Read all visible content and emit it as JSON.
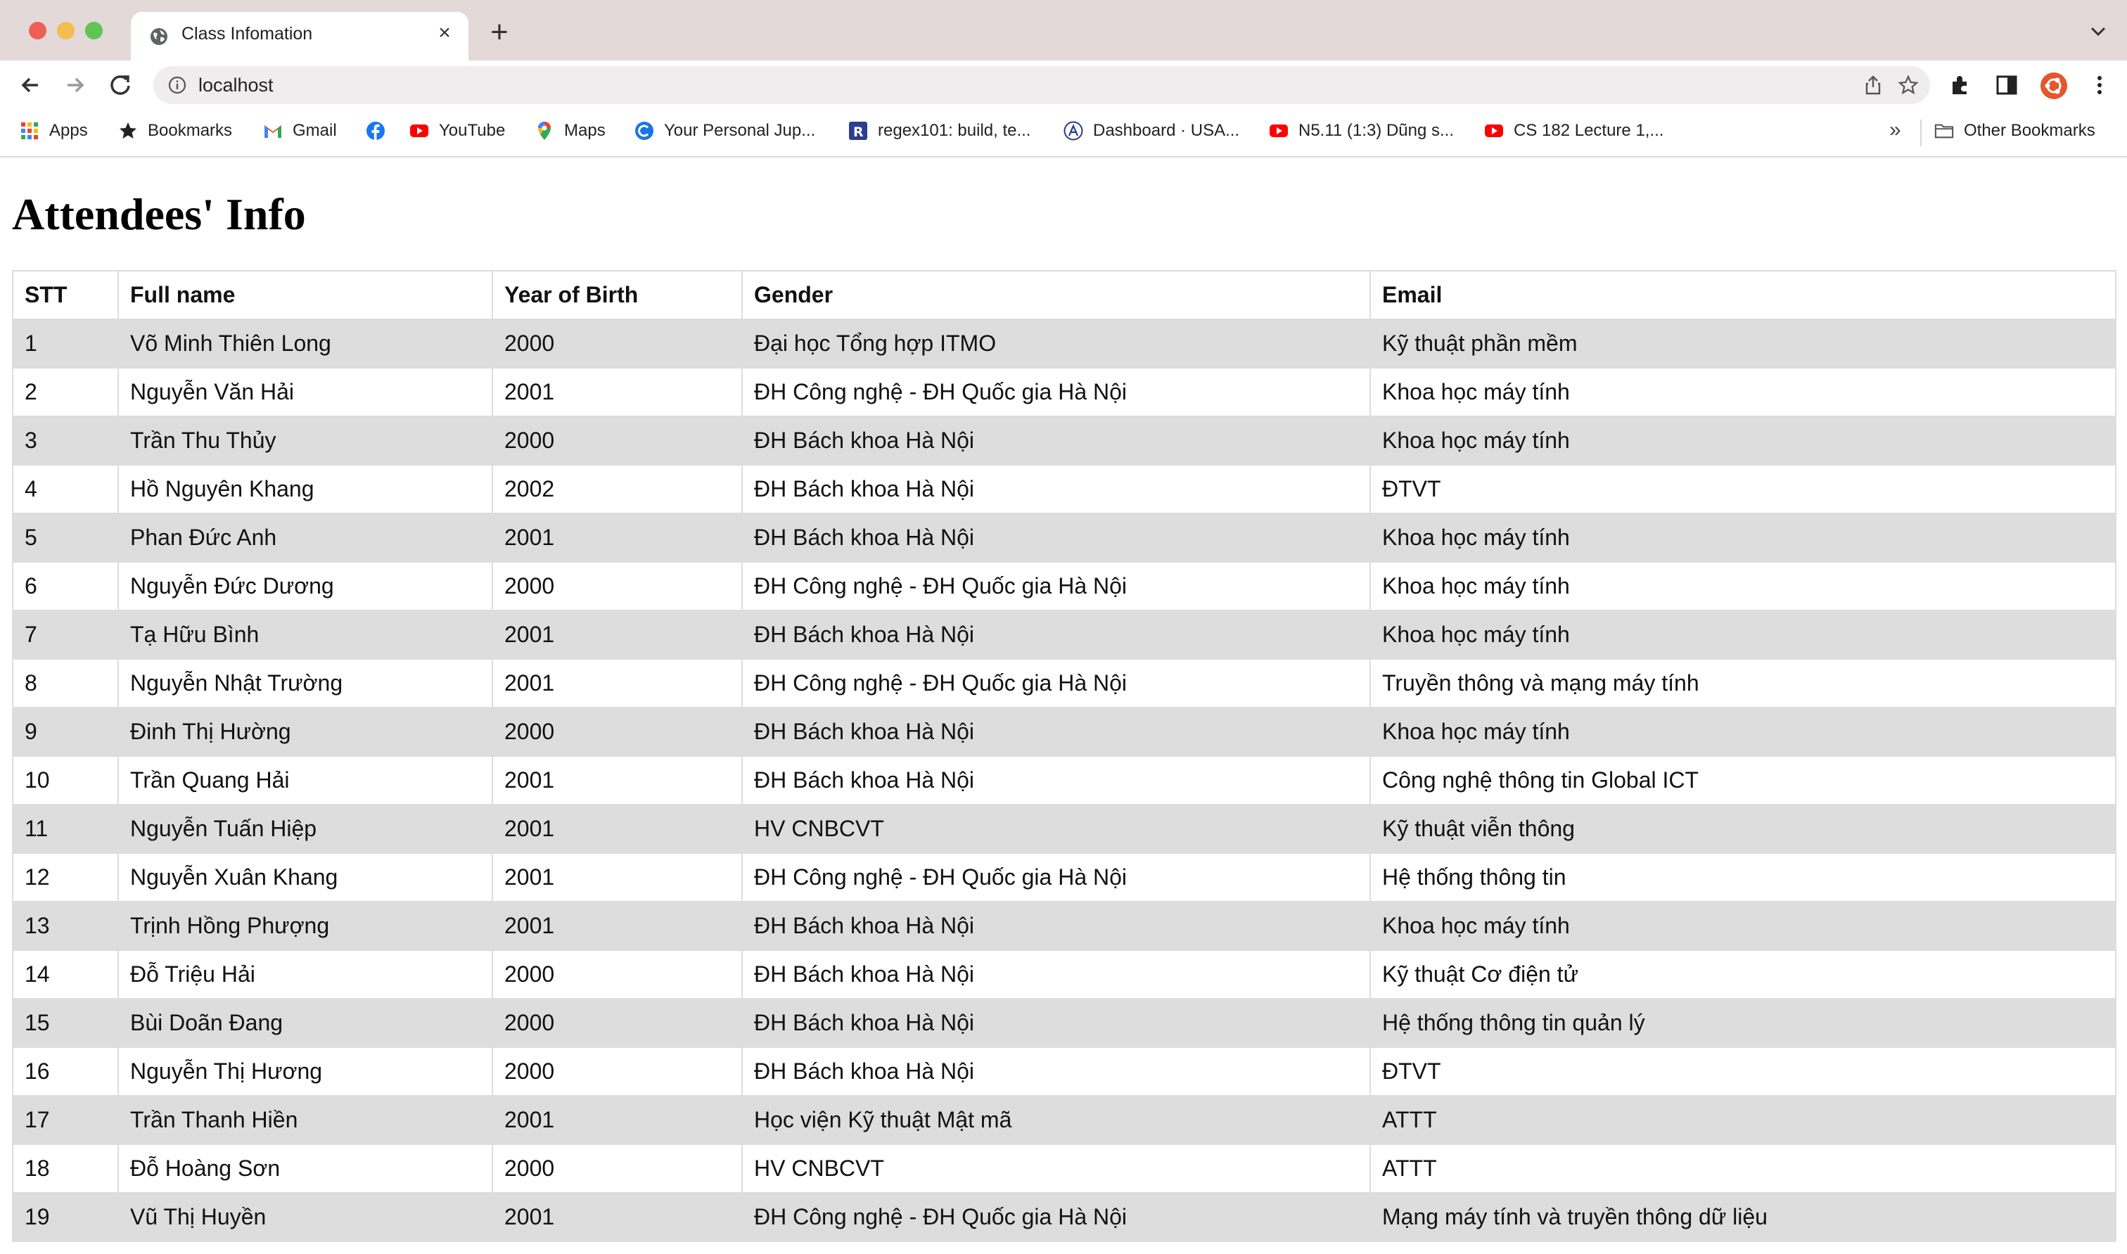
{
  "browser": {
    "tab_title": "Class Infomation",
    "url": "localhost",
    "bookmarks": [
      {
        "label": "Apps",
        "icon": "apps-grid-icon"
      },
      {
        "label": "Bookmarks",
        "icon": "star-icon"
      },
      {
        "label": "Gmail",
        "icon": "gmail-icon"
      },
      {
        "label": "",
        "icon": "facebook-icon"
      },
      {
        "label": "YouTube",
        "icon": "youtube-icon"
      },
      {
        "label": "Maps",
        "icon": "maps-pin-icon"
      },
      {
        "label": "Your Personal Jup...",
        "icon": "c-logo-icon"
      },
      {
        "label": "regex101: build, te...",
        "icon": "regex-icon"
      },
      {
        "label": "Dashboard · USA...",
        "icon": "dashboard-icon"
      },
      {
        "label": "N5.11 (1:3) Dũng s...",
        "icon": "youtube-icon"
      },
      {
        "label": "CS 182 Lecture 1,...",
        "icon": "youtube-icon"
      }
    ],
    "more_bookmarks": "»",
    "other_bookmarks": "Other Bookmarks"
  },
  "page": {
    "heading": "Attendees' Info",
    "columns": [
      "STT",
      "Full name",
      "Year of Birth",
      "Gender",
      "Email"
    ],
    "rows": [
      [
        "1",
        "Võ Minh Thiên Long",
        "2000",
        "Đại học Tổng hợp ITMO",
        "Kỹ thuật phần mềm"
      ],
      [
        "2",
        "Nguyễn Văn Hải",
        "2001",
        "ĐH Công nghệ - ĐH Quốc gia Hà Nội",
        "Khoa học máy tính"
      ],
      [
        "3",
        "Trần Thu Thủy",
        "2000",
        "ĐH Bách khoa Hà Nội",
        "Khoa học máy tính"
      ],
      [
        "4",
        "Hồ Nguyên Khang",
        "2002",
        "ĐH Bách khoa Hà Nội",
        "ĐTVT"
      ],
      [
        "5",
        "Phan Đức Anh",
        "2001",
        "ĐH Bách khoa Hà Nội",
        "Khoa học máy tính"
      ],
      [
        "6",
        "Nguyễn Đức Dương",
        "2000",
        "ĐH Công nghệ - ĐH Quốc gia Hà Nội",
        "Khoa học máy tính"
      ],
      [
        "7",
        "Tạ Hữu Bình",
        "2001",
        "ĐH Bách khoa Hà Nội",
        "Khoa học máy tính"
      ],
      [
        "8",
        "Nguyễn Nhật Trường",
        "2001",
        "ĐH Công nghệ - ĐH Quốc gia Hà Nội",
        "Truyền thông và mạng máy tính"
      ],
      [
        "9",
        "Đinh Thị Hường",
        "2000",
        "ĐH Bách khoa Hà Nội",
        "Khoa học máy tính"
      ],
      [
        "10",
        "Trần Quang Hải",
        "2001",
        "ĐH Bách khoa Hà Nội",
        "Công nghệ thông tin Global ICT"
      ],
      [
        "11",
        "Nguyễn Tuấn Hiệp",
        "2001",
        "HV CNBCVT",
        "Kỹ thuật viễn thông"
      ],
      [
        "12",
        "Nguyễn Xuân Khang",
        "2001",
        "ĐH Công nghệ - ĐH Quốc gia Hà Nội",
        "Hệ thống thông tin"
      ],
      [
        "13",
        "Trịnh Hồng Phượng",
        "2001",
        "ĐH Bách khoa Hà Nội",
        "Khoa học máy tính"
      ],
      [
        "14",
        "Đỗ Triệu Hải",
        "2000",
        "ĐH Bách khoa Hà Nội",
        "Kỹ thuật Cơ điện tử"
      ],
      [
        "15",
        "Bùi Doãn Đang",
        "2000",
        "ĐH Bách khoa Hà Nội",
        "Hệ thống thông tin quản lý"
      ],
      [
        "16",
        "Nguyễn Thị Hương",
        "2000",
        "ĐH Bách khoa Hà Nội",
        "ĐTVT"
      ],
      [
        "17",
        "Trần Thanh Hiền",
        "2001",
        "Học viện Kỹ thuật Mật mã",
        "ATTT"
      ],
      [
        "18",
        "Đỗ Hoàng Sơn",
        "2000",
        "HV CNBCVT",
        "ATTT"
      ],
      [
        "19",
        "Vũ Thị Huyền",
        "2001",
        "ĐH Công nghệ - ĐH Quốc gia Hà Nội",
        "Mạng máy tính và truyền thông dữ liệu"
      ]
    ]
  }
}
